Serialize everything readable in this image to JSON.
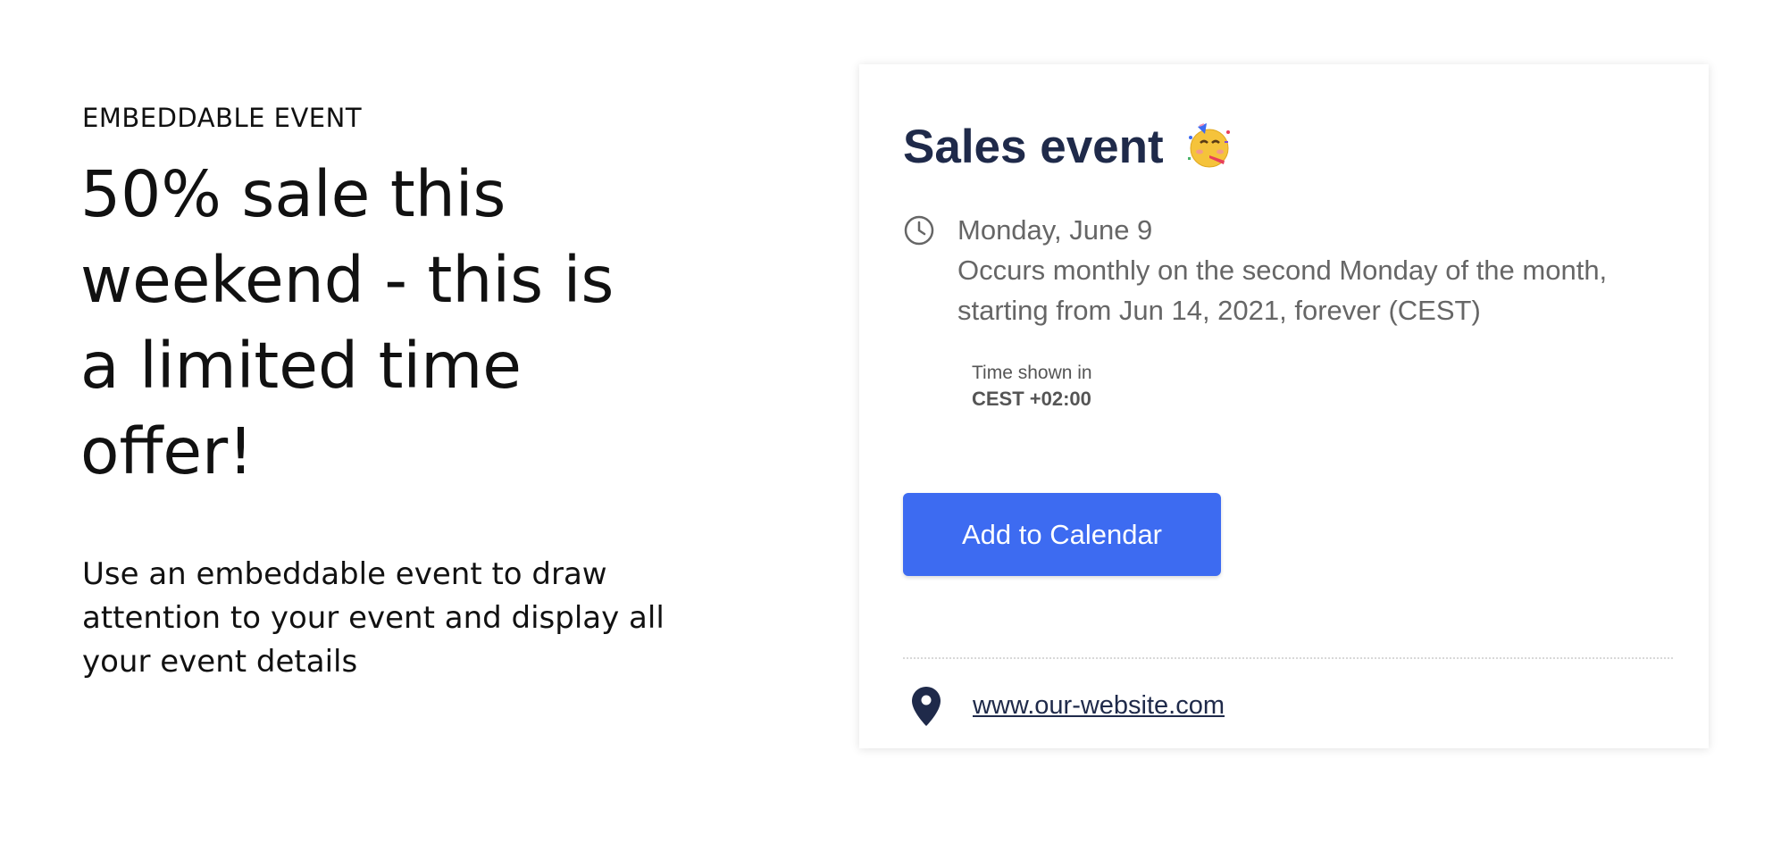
{
  "intro": {
    "eyebrow": "EMBEDDABLE EVENT",
    "headline": "50% sale this weekend - this is a limited time offer!",
    "description": "Use an embeddable event to draw attention to your event and display all your event details"
  },
  "event_card": {
    "title": "Sales event",
    "title_icon": "party-face-icon",
    "date": "Monday, June 9",
    "recurrence": "Occurs monthly on the second Monday of the month, starting from Jun 14, 2021, forever (CEST)",
    "timezone_label": "Time shown in",
    "timezone_value": "CEST +02:00",
    "add_button_label": "Add to Calendar",
    "location_link": "www.our-website.com",
    "colors": {
      "title": "#1f2a4a",
      "button": "#3d6bf1",
      "muted_text": "#666666"
    }
  }
}
